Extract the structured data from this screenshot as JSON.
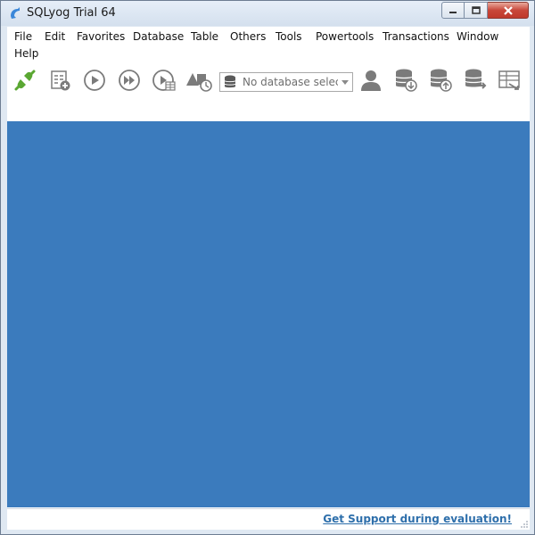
{
  "window": {
    "title": "SQLyog Trial 64",
    "controls": {
      "minimize": "minimize",
      "maximize": "maximize",
      "close": "close"
    }
  },
  "menu": {
    "items": [
      "File",
      "Edit",
      "Favorites",
      "Database",
      "Table",
      "Others",
      "Tools",
      "Powertools",
      "Transactions",
      "Window",
      "Help"
    ]
  },
  "toolbar": {
    "buttons": [
      "new-connection-icon",
      "new-query-editor-icon",
      "execute-query-icon",
      "execute-all-queries-icon",
      "execute-and-edit-icon",
      "schema-designer-icon",
      "user-manager-icon",
      "backup-database-icon",
      "restore-database-icon",
      "database-synchronization-icon",
      "import-table-icon"
    ],
    "database_selector": {
      "value": "No database selected",
      "icon": "database-icon"
    }
  },
  "status": {
    "support_link": "Get Support during evaluation!"
  },
  "colors": {
    "workspace": "#3b7bbd",
    "link": "#2e6fab",
    "connect_icon": "#5aa732",
    "toolbar_icon": "#7b7b7b"
  }
}
